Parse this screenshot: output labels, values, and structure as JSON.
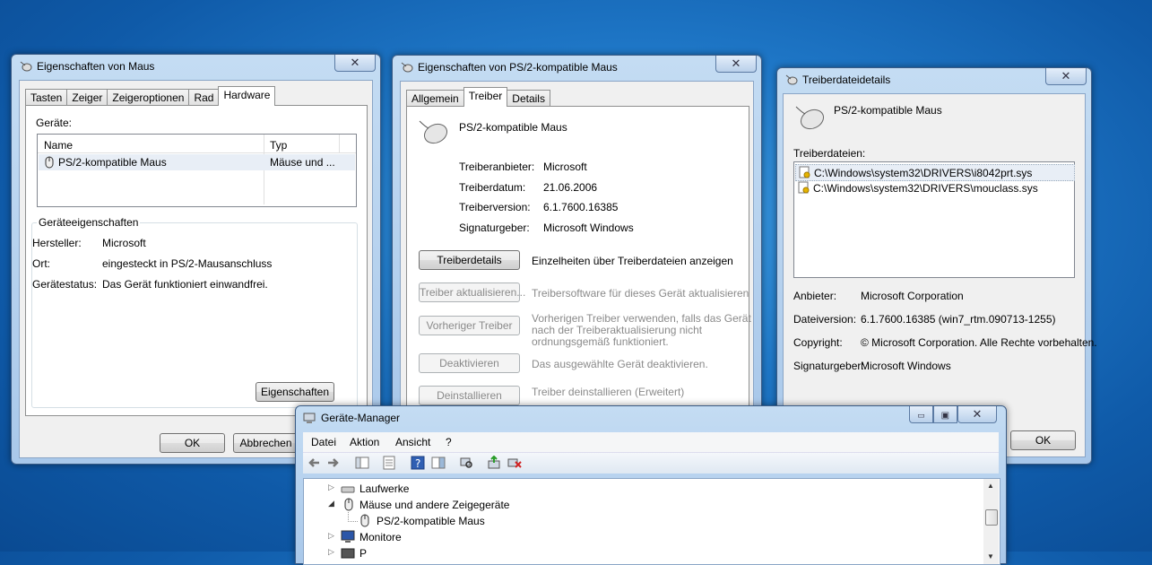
{
  "win1": {
    "title": "Eigenschaften von Maus",
    "close": "✕",
    "tabs": [
      "Tasten",
      "Zeiger",
      "Zeigeroptionen",
      "Rad",
      "Hardware"
    ],
    "devices_label": "Geräte:",
    "columns": [
      "Name",
      "Typ"
    ],
    "device_row": {
      "name": "PS/2-kompatible Maus",
      "type": "Mäuse und ..."
    },
    "props_title": "Geräteeigenschaften",
    "props": [
      {
        "k": "Hersteller:",
        "v": "Microsoft"
      },
      {
        "k": "Ort:",
        "v": "eingesteckt in PS/2-Mausanschluss"
      },
      {
        "k": "Gerätestatus:",
        "v": "Das Gerät funktioniert einwandfrei."
      }
    ],
    "properties_button": "Eigenschaften",
    "ok": "OK",
    "cancel": "Abbrechen"
  },
  "win2": {
    "title": "Eigenschaften von PS/2-kompatible Maus",
    "close": "✕",
    "tabs": [
      "Allgemein",
      "Treiber",
      "Details"
    ],
    "device_name": "PS/2-kompatible Maus",
    "info": [
      {
        "k": "Treiberanbieter:",
        "v": "Microsoft"
      },
      {
        "k": "Treiberdatum:",
        "v": "21.06.2006"
      },
      {
        "k": "Treiberversion:",
        "v": "6.1.7600.16385"
      },
      {
        "k": "Signaturgeber:",
        "v": "Microsoft Windows"
      }
    ],
    "actions": [
      {
        "label": "Treiberdetails",
        "desc": "Einzelheiten über Treiberdateien anzeigen"
      },
      {
        "label": "Treiber aktualisieren...",
        "desc": "Treibersoftware für dieses Gerät aktualisieren"
      },
      {
        "label": "Vorheriger Treiber",
        "desc1": "Vorherigen Treiber verwenden, falls das Gerät",
        "desc2": "nach der Treiberaktualisierung nicht",
        "desc3": "ordnungsgemäß funktioniert."
      },
      {
        "label": "Deaktivieren",
        "desc": "Das ausgewählte Gerät deaktivieren."
      },
      {
        "label": "Deinstallieren",
        "desc": "Treiber deinstallieren (Erweitert)"
      }
    ]
  },
  "win3": {
    "title": "Treiberdateidetails",
    "close": "✕",
    "device_name": "PS/2-kompatible Maus",
    "files_label": "Treiberdateien:",
    "files": [
      "C:\\Windows\\system32\\DRIVERS\\i8042prt.sys",
      "C:\\Windows\\system32\\DRIVERS\\mouclass.sys"
    ],
    "details": [
      {
        "k": "Anbieter:",
        "v": "Microsoft Corporation"
      },
      {
        "k": "Dateiversion:",
        "v": "6.1.7600.16385 (win7_rtm.090713-1255)"
      },
      {
        "k": "Copyright:",
        "v": "© Microsoft Corporation. Alle Rechte vorbehalten."
      },
      {
        "k": "Signaturgeber:",
        "v": "Microsoft Windows"
      }
    ],
    "ok": "OK"
  },
  "win4": {
    "title": "Geräte-Manager",
    "minimize": "▭",
    "maximize": "▣",
    "close": "✕",
    "menu": [
      "Datei",
      "Aktion",
      "Ansicht",
      "?"
    ],
    "tree": [
      {
        "label": "Laufwerke",
        "expander": "▷"
      },
      {
        "label": "Mäuse und andere Zeigegeräte",
        "expander": "◢"
      },
      {
        "label": "PS/2-kompatible Maus",
        "expander": ""
      },
      {
        "label": "Monitore",
        "expander": "▷"
      },
      {
        "label": "P",
        "expander": "▷"
      }
    ],
    "scroll_up": "▲",
    "scroll_down": "▼"
  }
}
